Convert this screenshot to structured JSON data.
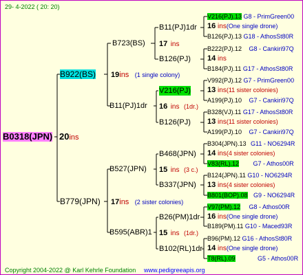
{
  "header": {
    "date": "29-  4-2022 ( 20: 20)"
  },
  "footer": {
    "copyright": "Copyright 2004-2022 @ Karl Kehrle Foundation",
    "url": "www.pedigreeapis.org"
  },
  "root": {
    "name": "B0318(JPN)",
    "count": "20",
    "ins": "ins"
  },
  "gen1": [
    {
      "name": "B922(BS)",
      "count": "19",
      "ins": "ins",
      "note": "(1 single colony)"
    },
    {
      "name": "B779(JPN)",
      "count": "17",
      "ins": "ins",
      "note": "(2 sister colonies)"
    }
  ],
  "gen2": [
    {
      "name": "B723(BS)",
      "count": "17",
      "ins": "ins",
      "note": ""
    },
    {
      "name": "B11(PJ)1dr",
      "count": "16",
      "ins": "ins",
      "note": "(1dr.)"
    },
    {
      "name": "B527(JPN)",
      "count": "15",
      "ins": "ins",
      "note": "(3 c.)"
    },
    {
      "name": "B595(ABR)1",
      "count": "15",
      "ins": "ins",
      "note": "(1dr.)"
    }
  ],
  "gen3": [
    {
      "name": "B11(PJ)1dr",
      "count": "16",
      "ins": "ins",
      "note": "(One single drone)"
    },
    {
      "name": "B126(PJ)",
      "count": "14",
      "ins": "ins",
      "note": ""
    },
    {
      "name": "V216(PJ)",
      "count": "13",
      "ins": "ins",
      "note": "(11 sister colonies)"
    },
    {
      "name": "B126(PJ)",
      "count": "13",
      "ins": "ins",
      "note": "(11 sister colonies)"
    },
    {
      "name": "B468(JPN)",
      "count": "14",
      "ins": "ins",
      "note": "(4 sister colonies)"
    },
    {
      "name": "B337(JPN)",
      "count": "13",
      "ins": "ins",
      "note": "(4 sister colonies)"
    },
    {
      "name": "B26(PM)1dr",
      "count": "16",
      "ins": "ins",
      "note": "(One single drone)"
    },
    {
      "name": "B102(RL)1dr",
      "count": "14",
      "ins": "ins",
      "note": "(One single drone)"
    }
  ],
  "gen4": [
    {
      "name": "V216(PJ).13",
      "src": "G8 - PrimGreen00"
    },
    {
      "name": "B126(PJ).13",
      "src": "G18 - AthosSt80R"
    },
    {
      "name": "B222(PJ).12",
      "src": "G8 - Cankiri97Q"
    },
    {
      "name": "B184(PJ).11",
      "src": "G17 - AthosSt80R"
    },
    {
      "name": "V992(PJ).12",
      "src": "G7 - PrimGreen00"
    },
    {
      "name": "A199(PJ).10",
      "src": "G7 - Cankiri97Q"
    },
    {
      "name": "B328(VJ).11",
      "src": "G17 - AthosSt80R"
    },
    {
      "name": "A199(PJ).10",
      "src": "G7 - Cankiri97Q"
    },
    {
      "name": "B304(JPN).13",
      "src": "G11 - NO6294R"
    },
    {
      "name": "V83(RL).12",
      "src": "G7 - Athos00R"
    },
    {
      "name": "B124(JPN).11",
      "src": "G10 - NO6294R"
    },
    {
      "name": "B801(BOP).08",
      "src": "G9 - NO6294R"
    },
    {
      "name": "V97(PM).12",
      "src": "G8 - Athos00R"
    },
    {
      "name": "B189(PM).11",
      "src": "G10 - Maced93R"
    },
    {
      "name": "B96(PM).12",
      "src": "G16 - AthosSt80R"
    },
    {
      "name": "T8(RL).09",
      "src": "G5 - Athos00R"
    }
  ]
}
